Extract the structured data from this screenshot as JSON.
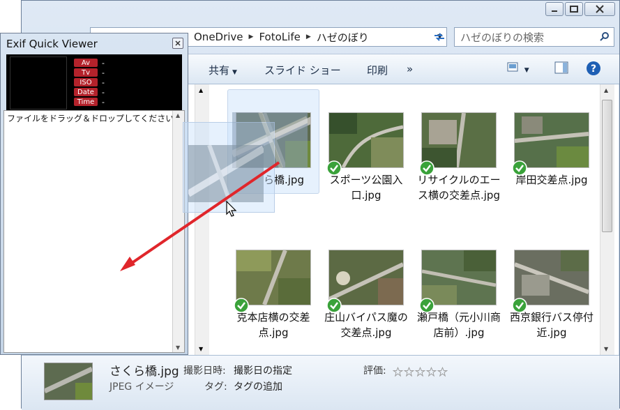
{
  "explorer": {
    "breadcrumb": [
      "OneDrive",
      "FotoLife",
      "ハゼのぼり"
    ],
    "search_placeholder": "ハゼのぼりの検索",
    "toolbar": {
      "share": "共有",
      "slideshow": "スライド ショー",
      "print": "印刷",
      "more": "»"
    },
    "items": [
      {
        "label": "さくら橋.jpg",
        "checked": false,
        "selected": true
      },
      {
        "label": "スポーツ公園入口.jpg",
        "checked": true
      },
      {
        "label": "リサイクルのエース横の交差点.jpg",
        "checked": true
      },
      {
        "label": "岸田交差点.jpg",
        "checked": true
      },
      {
        "label": "克本店横の交差点.jpg",
        "checked": true
      },
      {
        "label": "庄山バイパス魔の交差点.jpg",
        "checked": true
      },
      {
        "label": "瀬戸橋（元小川商店前）.jpg",
        "checked": true
      },
      {
        "label": "西京銀行バス停付近.jpg",
        "checked": true
      }
    ],
    "selected_label_visible": "ら橋.jpg",
    "details": {
      "filename": "さくら橋.jpg",
      "filetype": "JPEG イメージ",
      "date_label": "撮影日時:",
      "date_value": "撮影日の指定",
      "tag_label": "タグ:",
      "tag_value": "タグの追加",
      "rating_label": "評価:",
      "rating": 0
    }
  },
  "exif": {
    "title": "Exif Quick Viewer",
    "rows": [
      {
        "tag": "Av",
        "value": "-"
      },
      {
        "tag": "Tv",
        "value": "-"
      },
      {
        "tag": "ISO",
        "value": "-"
      },
      {
        "tag": "Date",
        "value": "-"
      },
      {
        "tag": "Time",
        "value": "-"
      }
    ],
    "drop_message": "ファイルをドラッグ＆ドロップしてください。"
  },
  "colors": {
    "arrow": "#e0262b",
    "check": "#3aa23a",
    "exif_tag": "#b4222b"
  }
}
